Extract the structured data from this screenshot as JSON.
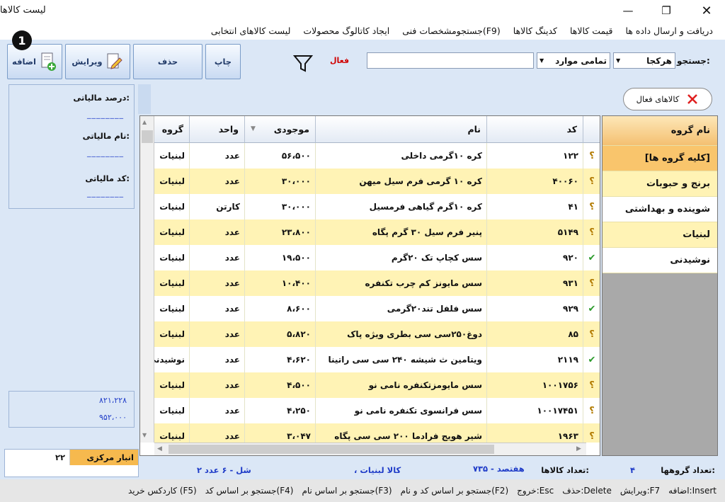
{
  "window": {
    "title": "لیست کالاها"
  },
  "menu": [
    "دریافت و ارسال داده ها",
    "قیمت کالاها",
    "کدینگ کالاها",
    "جستجومشخصات فنی(F9)",
    "ایجاد کاتالوگ محصولات",
    "لیست کالاهای انتخابی"
  ],
  "toolbar": {
    "add_label": "اضافه",
    "edit_label": "ویرایش",
    "delete_label": "حذف",
    "print_label": "چاپ",
    "badge": "1"
  },
  "search": {
    "label": "جستجو:",
    "field_value": "هرکجا",
    "scope_value": "تمامی موارد",
    "active_label": "فعال",
    "query": ""
  },
  "tax": {
    "percent_label": "درصد مالیاتی:",
    "name_label": "نام مالیاتی:",
    "code_label": "کد مالیاتی:",
    "placeholder": "________"
  },
  "active_goods_button": "کالاهای فعال",
  "grid": {
    "columns": {
      "code": "کد",
      "name": "نام",
      "stock": "موجودی",
      "unit": "واحد",
      "group": "گروه"
    },
    "rows": [
      {
        "code": "۱۲۲",
        "name": "کره ۱۰گرمی داخلی",
        "stock": "۵۶،۵۰۰",
        "unit": "عدد",
        "group": "لبنیات",
        "mark": "؟"
      },
      {
        "code": "۴۰۰۶۰",
        "name": "کره ۱۰ گرمی فرم سیل میهن",
        "stock": "۳۰،۰۰۰",
        "unit": "عدد",
        "group": "لبنیات",
        "mark": "؟"
      },
      {
        "code": "۴۱",
        "name": "کره ۱۰گرم گیاهی فرمسیل",
        "stock": "۳۰،۰۰۰",
        "unit": "کارتن",
        "group": "لبنیات",
        "mark": "؟"
      },
      {
        "code": "۵۱۴۹",
        "name": "پنیر فرم سیل ۳۰ گرم پگاه",
        "stock": "۲۳،۸۰۰",
        "unit": "عدد",
        "group": "لبنیات",
        "mark": "؟"
      },
      {
        "code": "۹۲۰",
        "name": "سس کچاپ تک ۲۰گرم",
        "stock": "۱۹،۵۰۰",
        "unit": "عدد",
        "group": "لبنیات",
        "mark": "✔"
      },
      {
        "code": "۹۳۱",
        "name": "سس مایونز کم چرب تکنفره",
        "stock": "۱۰،۴۰۰",
        "unit": "عدد",
        "group": "لبنیات",
        "mark": "؟"
      },
      {
        "code": "۹۲۹",
        "name": "سس فلفل تند۲۰گرمی",
        "stock": "۸،۶۰۰",
        "unit": "عدد",
        "group": "لبنیات",
        "mark": "✔"
      },
      {
        "code": "۸۵",
        "name": "دوغ۲۵۰سی سی بطری ویژه پاک",
        "stock": "۵،۸۲۰",
        "unit": "عدد",
        "group": "لبنیات",
        "mark": "؟"
      },
      {
        "code": "۲۱۱۹",
        "name": "ویتامین ث شیشه ۲۴۰ سی سی راتینا",
        "stock": "۴،۶۲۰",
        "unit": "عدد",
        "group": "نوشیدنی",
        "mark": "✔"
      },
      {
        "code": "۱۰۰۱۷۵۶",
        "name": "سس مایومزتکنفره نامی نو",
        "stock": "۴،۵۰۰",
        "unit": "عدد",
        "group": "لبنیات",
        "mark": "؟"
      },
      {
        "code": "۱۰۰۱۷۴۵۱",
        "name": "سس فرانسوی تکنفره نامی نو",
        "stock": "۴،۲۵۰",
        "unit": "عدد",
        "group": "لبنیات",
        "mark": "؟"
      },
      {
        "code": "۱۹۶۳",
        "name": "شیر هویج فرادما ۲۰۰ سی سی پگاه",
        "stock": "۳،۰۴۷",
        "unit": "عدد",
        "group": "لبنیات",
        "mark": "؟"
      }
    ]
  },
  "groups": {
    "header": "نام گروه",
    "items": [
      "[کلیه گروه ها]",
      "برنج و حبوبات",
      "شوینده و بهداشتی",
      "لبنیات",
      "نوشیدنی"
    ]
  },
  "totals": {
    "value1": "۸۲۱،۲۲۸",
    "value2": "۹۵۲،۰۰۰"
  },
  "warehouse": {
    "name": "انبار مرکزی",
    "count": "۲۲"
  },
  "info": {
    "groups_count_label": "تعداد گروهها:",
    "groups_count": "۴",
    "goods_count_label": "تعداد کالاها:",
    "goods_count": "۷۳۵ - هفتصد",
    "goods_label": "، کالا لبنیات",
    "misc": "۲ شل - ۶ عدد"
  },
  "shortcuts": [
    "اضافه:Insert",
    "ویرایش:F7",
    "حذف:Delete",
    "خروج:Esc",
    "جستجو بر اساس کد و نام(F2)",
    "جستجو بر اساس نام(F3)",
    "جستجو بر اساس کد(F4)",
    "کاردکس خرید (F5)"
  ],
  "colors": {
    "row_yellow": "#fff3b5",
    "row_white": "#ffffff",
    "header_orange": "#f9c56c",
    "link_blue": "#1f3cc8",
    "active_red": "#d00000",
    "check_green": "#2a9a2a",
    "question_gold": "#b27a00"
  }
}
